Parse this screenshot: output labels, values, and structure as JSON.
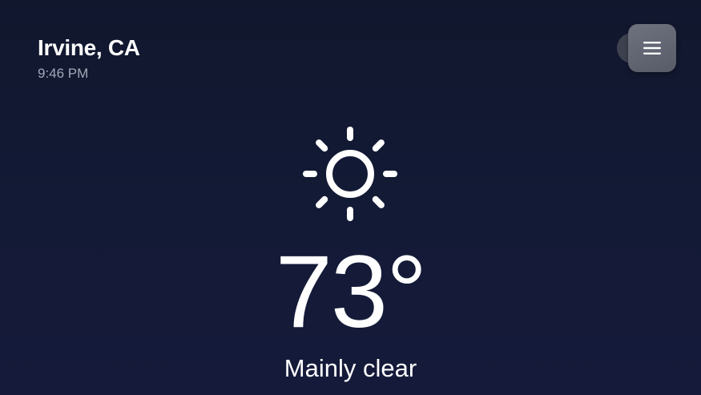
{
  "location": {
    "city": "Irvine, CA",
    "time": "9:46 PM"
  },
  "menu": {
    "icon": "hamburger-menu-icon"
  },
  "current": {
    "icon": "sun-icon",
    "temperature": "73°",
    "condition": "Mainly clear"
  },
  "colors": {
    "background_top": "#11172d",
    "background_bottom": "#151a3a",
    "secondary_text": "#a3a8b8",
    "menu_button": "#62656f"
  }
}
